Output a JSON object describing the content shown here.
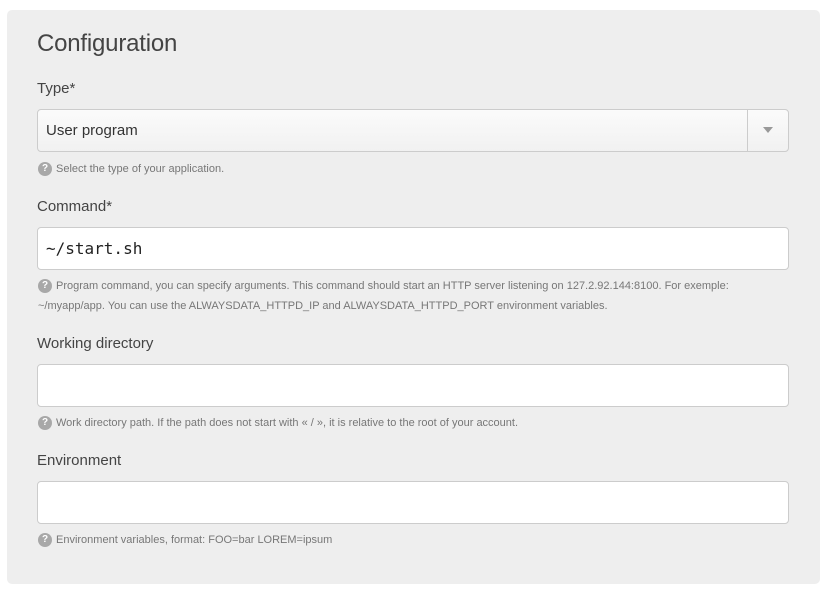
{
  "section": {
    "title": "Configuration"
  },
  "type_field": {
    "label": "Type*",
    "value": "User program",
    "help": "Select the type of your application."
  },
  "command_field": {
    "label": "Command*",
    "value": "~/start.sh",
    "help": "Program command, you can specify arguments. This command should start an HTTP server listening on 127.2.92.144:8100. For exemple: ~/myapp/app. You can use the ALWAYSDATA_HTTPD_IP and ALWAYSDATA_HTTPD_PORT environment variables."
  },
  "working_directory_field": {
    "label": "Working directory",
    "value": "",
    "help": "Work directory path. If the path does not start with « / », it is relative to the root of your account."
  },
  "environment_field": {
    "label": "Environment",
    "value": "",
    "help": "Environment variables, format: FOO=bar LOREM=ipsum"
  },
  "icons": {
    "help_glyph": "?",
    "help_icon": "question-circle-icon",
    "dropdown_icon": "caret-down-icon"
  },
  "colors": {
    "panel_background": "#eeeeee",
    "text": "#444444",
    "help_text": "#777777",
    "border": "#cccccc"
  }
}
